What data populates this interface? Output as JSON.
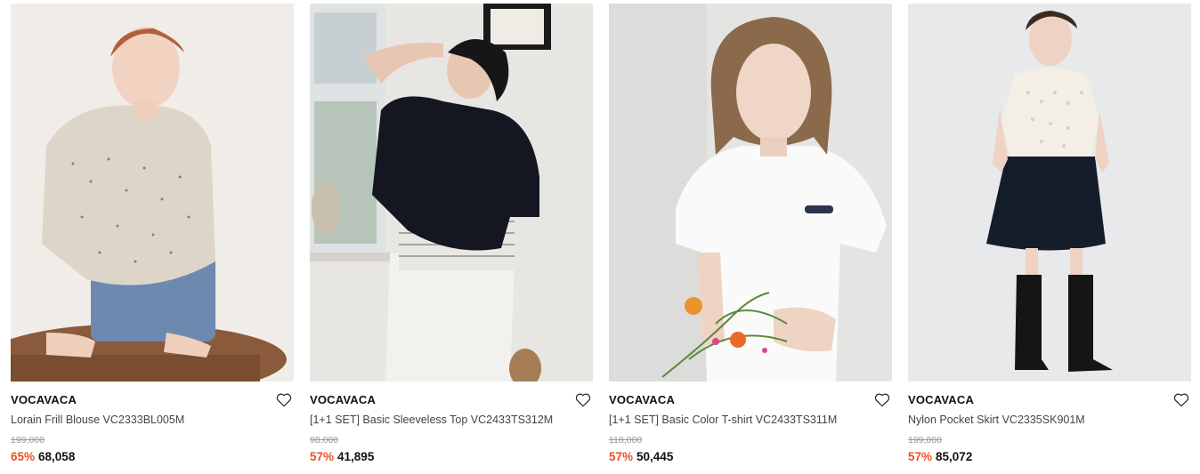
{
  "products": [
    {
      "brand": "VOCAVACA",
      "name": "Lorain Frill Blouse VC2333BL005M",
      "original_price": "199,000",
      "discount": "65%",
      "price": "68,058",
      "image_icon": "product-photo"
    },
    {
      "brand": "VOCAVACA",
      "name": "[1+1 SET] Basic Sleeveless Top VC2433TS312M",
      "original_price": "98,000",
      "discount": "57%",
      "price": "41,895",
      "image_icon": "product-photo"
    },
    {
      "brand": "VOCAVACA",
      "name": "[1+1 SET] Basic Color T-shirt VC2433TS311M",
      "original_price": "118,000",
      "discount": "57%",
      "price": "50,445",
      "image_icon": "product-photo"
    },
    {
      "brand": "VOCAVACA",
      "name": "Nylon Pocket Skirt VC2335SK901M",
      "original_price": "199,000",
      "discount": "57%",
      "price": "85,072",
      "image_icon": "product-photo"
    }
  ],
  "colors": {
    "discount": "#f04f23",
    "text": "#111111",
    "muted": "#9a9a9a"
  },
  "wishlist_icon": "heart-outline-icon"
}
